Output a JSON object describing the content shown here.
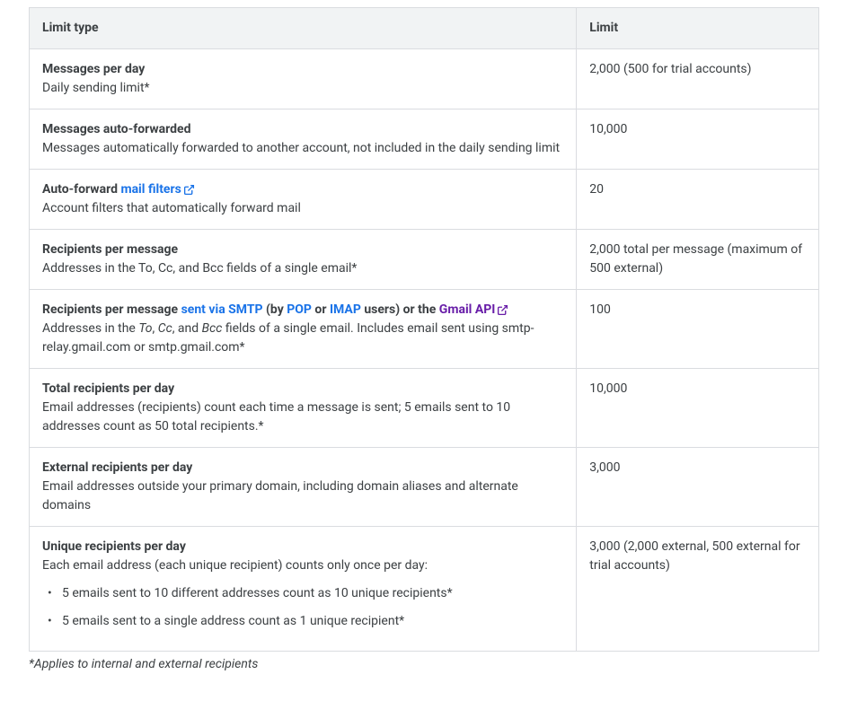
{
  "table": {
    "headers": {
      "col1": "Limit type",
      "col2": "Limit"
    },
    "rows": {
      "messages_per_day": {
        "title": "Messages per day",
        "desc": "Daily sending limit*",
        "limit": "2,000 (500 for trial accounts)"
      },
      "messages_auto_forwarded": {
        "title": "Messages auto-forwarded",
        "desc": "Messages automatically forwarded to another account, not included in the daily sending limit",
        "limit": "10,000"
      },
      "auto_forward_filters": {
        "title_prefix": "Auto-forward ",
        "link_text": "mail filters",
        "desc": "Account filters that automatically forward mail",
        "limit": "20"
      },
      "recipients_per_message": {
        "title": "Recipients per message",
        "desc": "Addresses in the To, Cc, and Bcc fields of a single email*",
        "limit": "2,000 total per message (maximum of 500 external)"
      },
      "recipients_smtp": {
        "title_prefix": "Recipients per message ",
        "link1": "sent via SMTP",
        "mid1": " (by ",
        "link2": "POP",
        "mid2": " or ",
        "link3": "IMAP",
        "mid3": " users) or the ",
        "link4": "Gmail API",
        "desc_prefix": "Addresses in the ",
        "d_to": "To",
        "d_sep1": ", ",
        "d_cc": "Cc",
        "d_sep2": ", and ",
        "d_bcc": "Bcc",
        "desc_suffix": " fields of a single email. Includes email sent using smtp-relay.gmail.com or smtp.gmail.com*",
        "limit": "100"
      },
      "total_recipients_per_day": {
        "title": "Total recipients per day",
        "desc": "Email addresses (recipients) count each time a message is sent; 5 emails sent to 10 addresses count as 50 total recipients.*",
        "limit": "10,000"
      },
      "external_recipients_per_day": {
        "title": "External recipients per day",
        "desc": "Email addresses outside your primary domain, including domain aliases and alternate domains",
        "limit": "3,000"
      },
      "unique_recipients_per_day": {
        "title": "Unique recipients per day",
        "desc": "Each email address (each unique recipient) counts only once per day:",
        "bullet1": "5 emails sent to 10 different addresses count as 10 unique recipients*",
        "bullet2": "5 emails sent to a single address count as 1 unique recipient*",
        "limit": "3,000 (2,000 external, 500 external for trial accounts)"
      }
    }
  },
  "footnote": "*Applies to internal and external recipients"
}
